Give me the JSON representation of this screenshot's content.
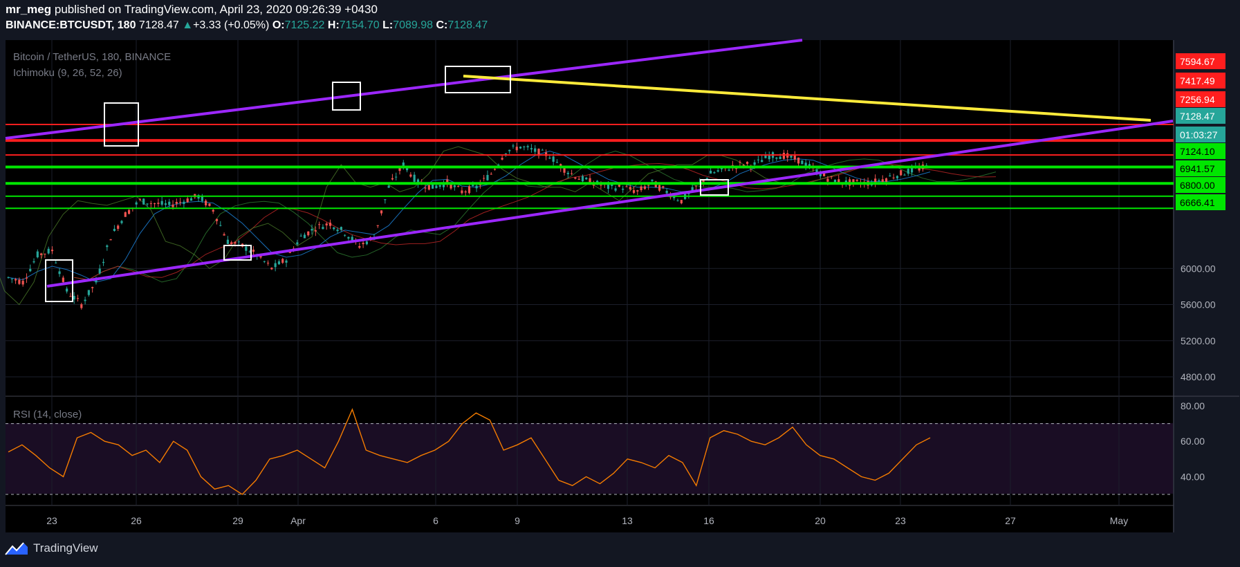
{
  "header": {
    "author": "mr_meg",
    "published_text": " published on TradingView.com, April 23, 2020 09:26:39 +0430",
    "symbol": "BINANCE:BTCUSDT, 180",
    "last": "7128.47",
    "change_arrow": "▲",
    "change": "+3.33 (+0.05%)",
    "o_label": "O:",
    "o_val": "7125.22",
    "h_label": "H:",
    "h_val": "7154.70",
    "l_label": "L:",
    "l_val": "7089.98",
    "c_label": "C:",
    "c_val": "7128.47"
  },
  "pane_legend": {
    "title": "Bitcoin / TetherUS, 180, BINANCE",
    "indicator": "Ichimoku (9, 26, 52, 26)",
    "rsi": "RSI (14, close)"
  },
  "footer": {
    "brand": "TradingView",
    "logo_icon": "tradingview-logo-icon"
  },
  "colors": {
    "background": "#131722",
    "pane": "#000000",
    "resistance": "#ff1e1e",
    "support": "#00e600",
    "channel": "#9c27ff",
    "downtrend": "#ffeb3b",
    "rsi_line": "#f57c00",
    "candle_up": "#26a69a",
    "candle_down": "#ef5350",
    "current_price": "#26a69a"
  },
  "chart_data": {
    "type": "candlestick",
    "title": "Bitcoin / TetherUS, 180, BINANCE",
    "x_ticks": [
      "23",
      "26",
      "29",
      "Apr",
      "6",
      "9",
      "13",
      "16",
      "20",
      "23",
      "27",
      "May"
    ],
    "y_ticks": [
      4800.0,
      5200.0,
      5600.0,
      6000.0
    ],
    "ylim": [
      4600,
      7750
    ],
    "price_labels": [
      {
        "value": "7594.67",
        "role": "resistance"
      },
      {
        "value": "7417.49",
        "role": "resistance"
      },
      {
        "value": "7256.94",
        "role": "resistance"
      },
      {
        "value": "7128.47",
        "role": "current"
      },
      {
        "value": "01:03:27",
        "role": "countdown"
      },
      {
        "value": "7124.10",
        "role": "support"
      },
      {
        "value": "6941.57",
        "role": "support"
      },
      {
        "value": "6800.00",
        "role": "support"
      },
      {
        "value": "6666.41",
        "role": "support"
      }
    ],
    "horizontal_levels": {
      "resistance": [
        7594.67,
        7417.49,
        7256.94
      ],
      "support": [
        7124.1,
        6941.57,
        6800.0,
        6666.41
      ]
    },
    "close_path": [
      5900,
      5850,
      6150,
      6200,
      5750,
      5600,
      5850,
      6350,
      6600,
      6750,
      6720,
      6700,
      6750,
      6800,
      6650,
      6300,
      6250,
      6150,
      6000,
      6100,
      6350,
      6450,
      6500,
      6400,
      6250,
      6350,
      6900,
      7150,
      6950,
      6900,
      6950,
      6850,
      6900,
      7050,
      7300,
      7350,
      7300,
      7250,
      7100,
      7000,
      6950,
      6900,
      6900,
      6850,
      6950,
      6850,
      6750,
      6900,
      7050,
      7100,
      7150,
      7150,
      7250,
      7250,
      7200,
      7100,
      7000,
      6950,
      6950,
      6950,
      7000,
      7050,
      7100,
      7128
    ],
    "rsi": {
      "name": "RSI (14, close)",
      "y_ticks": [
        80.0,
        60.0,
        40.0
      ],
      "bands": [
        70,
        30
      ],
      "ylim": [
        25,
        85
      ],
      "values": [
        54,
        58,
        52,
        45,
        40,
        62,
        65,
        60,
        58,
        52,
        55,
        48,
        60,
        55,
        40,
        33,
        35,
        30,
        38,
        50,
        52,
        55,
        50,
        45,
        60,
        78,
        55,
        52,
        50,
        48,
        52,
        55,
        60,
        70,
        76,
        72,
        55,
        58,
        62,
        50,
        38,
        35,
        40,
        36,
        42,
        50,
        48,
        45,
        52,
        48,
        35,
        62,
        66,
        64,
        60,
        58,
        62,
        68,
        58,
        52,
        50,
        45,
        40,
        38,
        42,
        50,
        58,
        62
      ]
    }
  }
}
